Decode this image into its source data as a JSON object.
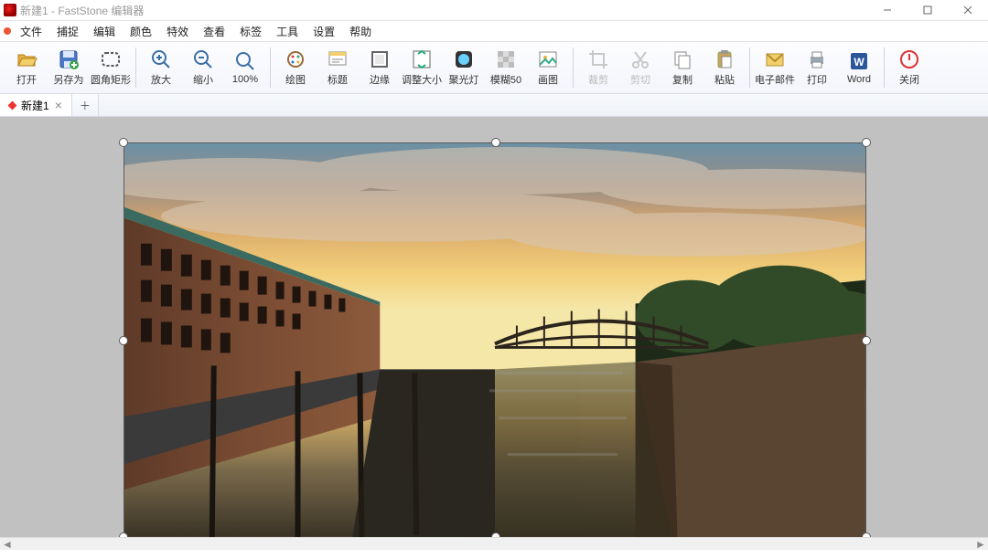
{
  "title": "新建1 - FastStone 编辑器",
  "menu": [
    "文件",
    "捕捉",
    "编辑",
    "颜色",
    "特效",
    "查看",
    "标签",
    "工具",
    "设置",
    "帮助"
  ],
  "toolbar": [
    {
      "icon": "open",
      "label": "打开"
    },
    {
      "icon": "saveas",
      "label": "另存为"
    },
    {
      "icon": "roundrect",
      "label": "圆角矩形"
    },
    {
      "sep": true
    },
    {
      "icon": "zoomin",
      "label": "放大"
    },
    {
      "icon": "zoomout",
      "label": "缩小"
    },
    {
      "icon": "zoom100",
      "label": "100%"
    },
    {
      "sep": true
    },
    {
      "icon": "draw",
      "label": "绘图"
    },
    {
      "icon": "caption",
      "label": "标题"
    },
    {
      "icon": "edge",
      "label": "边缘"
    },
    {
      "icon": "resize",
      "label": "调整大小"
    },
    {
      "icon": "spotlight",
      "label": "聚光灯"
    },
    {
      "icon": "blur",
      "label": "模糊50"
    },
    {
      "icon": "picture",
      "label": "画图"
    },
    {
      "sep": true
    },
    {
      "icon": "crop",
      "label": "裁剪",
      "disabled": true
    },
    {
      "icon": "cut",
      "label": "剪切",
      "disabled": true
    },
    {
      "icon": "copy",
      "label": "复制"
    },
    {
      "icon": "paste",
      "label": "粘贴"
    },
    {
      "sep": true
    },
    {
      "icon": "email",
      "label": "电子邮件"
    },
    {
      "icon": "print",
      "label": "打印"
    },
    {
      "icon": "word",
      "label": "Word"
    },
    {
      "sep": true
    },
    {
      "icon": "close",
      "label": "关闭"
    }
  ],
  "tabs": [
    {
      "label": "新建1",
      "dirty": true
    }
  ]
}
